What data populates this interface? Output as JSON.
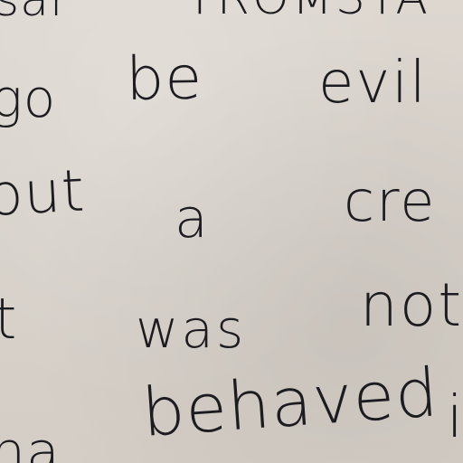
{
  "document": {
    "lines": [
      {
        "words": [
          "sar",
          "TROMSTA"
        ]
      },
      {
        "words": [
          "go",
          "be",
          "evil"
        ]
      },
      {
        "words": [
          "out",
          "a",
          "cre"
        ]
      },
      {
        "words": [
          "t",
          "was",
          "not"
        ]
      },
      {
        "words": [
          "ha",
          "behaved",
          "i"
        ]
      }
    ]
  }
}
